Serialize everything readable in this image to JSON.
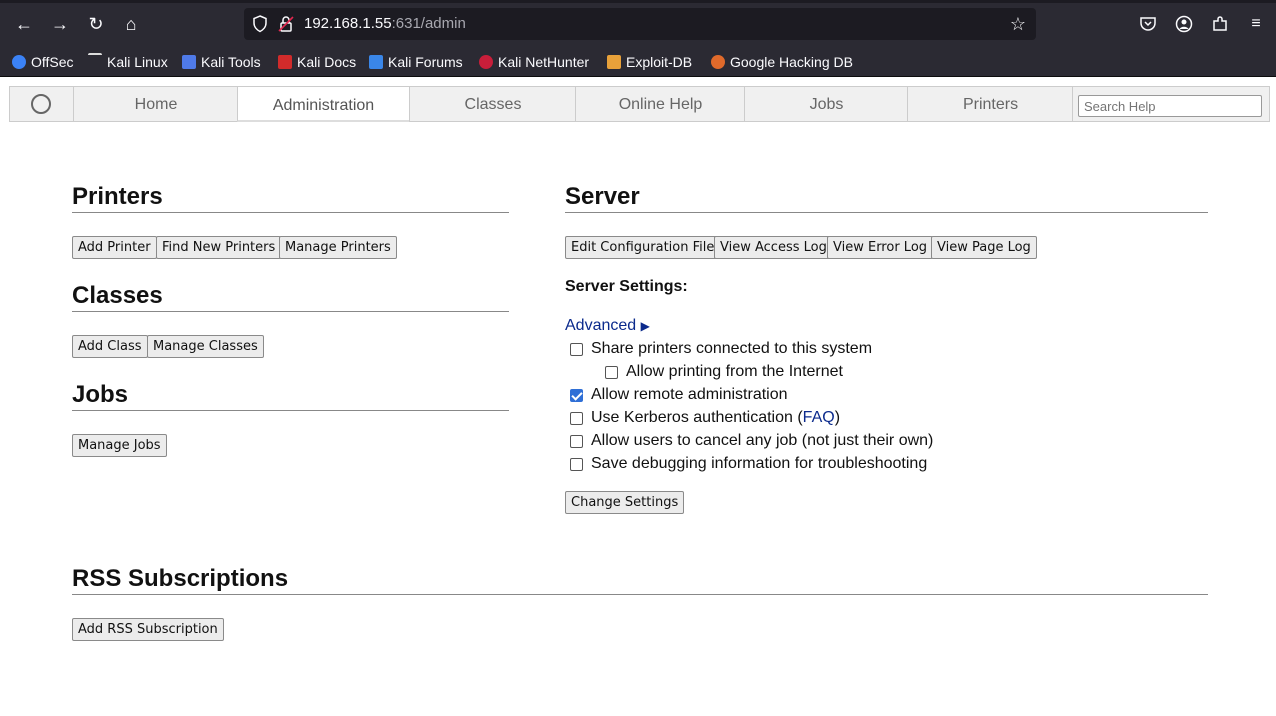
{
  "browser": {
    "url_host": "192.168.1.55",
    "url_rest": ":631/admin",
    "bookmarks": [
      "OffSec",
      "Kali Linux",
      "Kali Tools",
      "Kali Docs",
      "Kali Forums",
      "Kali NetHunter",
      "Exploit-DB",
      "Google Hacking DB"
    ]
  },
  "nav": {
    "tabs": [
      "Home",
      "Administration",
      "Classes",
      "Online Help",
      "Jobs",
      "Printers"
    ],
    "active": "Administration",
    "search_placeholder": "Search Help"
  },
  "printers": {
    "heading": "Printers",
    "buttons": [
      "Add Printer",
      "Find New Printers",
      "Manage Printers"
    ]
  },
  "classes": {
    "heading": "Classes",
    "buttons": [
      "Add Class",
      "Manage Classes"
    ]
  },
  "jobs": {
    "heading": "Jobs",
    "buttons": [
      "Manage Jobs"
    ]
  },
  "server": {
    "heading": "Server",
    "buttons": [
      "Edit Configuration File",
      "View Access Log",
      "View Error Log",
      "View Page Log"
    ],
    "settings_label": "Server Settings:",
    "advanced_label": "Advanced",
    "advanced_arrow": "▶",
    "options": [
      {
        "label": "Share printers connected to this system",
        "checked": false
      },
      {
        "label": "Allow printing from the Internet",
        "checked": false
      },
      {
        "label": "Allow remote administration",
        "checked": true
      },
      {
        "label": "Use Kerberos authentication (",
        "link": "FAQ",
        "suffix": ")",
        "checked": false
      },
      {
        "label": "Allow users to cancel any job (not just their own)",
        "checked": false
      },
      {
        "label": "Save debugging information for troubleshooting",
        "checked": false
      }
    ],
    "change_button": "Change Settings"
  },
  "rss": {
    "heading": "RSS Subscriptions",
    "button": "Add RSS Subscription"
  }
}
